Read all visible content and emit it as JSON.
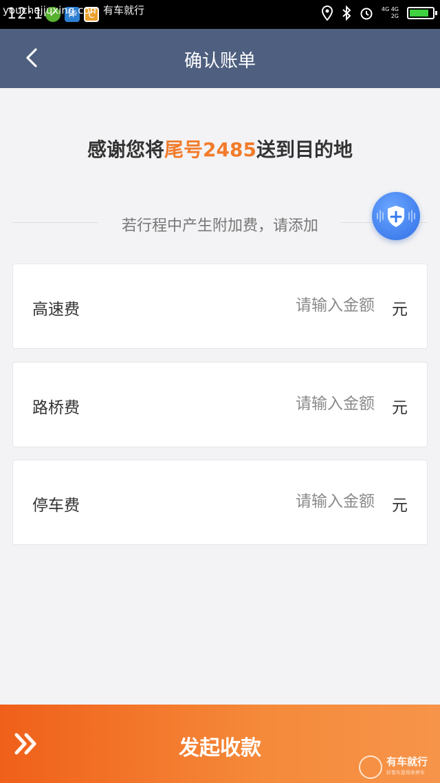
{
  "status_bar": {
    "time": "12:14",
    "watermark": "youchejiuxing.com 有车就行",
    "app_icons": [
      "app-green-icon",
      "app-blue-icon",
      "app-orange-icon"
    ],
    "network_top": "4G 4G",
    "network_bottom": "2G",
    "battery_level": 0.85,
    "battery_color": "#3fd13f"
  },
  "header": {
    "title": "确认账单",
    "background": "#4e5f7f"
  },
  "thanks": {
    "prefix": "感谢您将",
    "highlight": "尾号2485",
    "suffix": "送到目的地",
    "highlight_color": "#f27b2a"
  },
  "hint": {
    "text": "若行程中产生附加费，请添加"
  },
  "fees": [
    {
      "label": "高速费",
      "placeholder": "请输入金额",
      "value": "",
      "unit": "元"
    },
    {
      "label": "路桥费",
      "placeholder": "请输入金额",
      "value": "",
      "unit": "元"
    },
    {
      "label": "停车费",
      "placeholder": "请输入金额",
      "value": "",
      "unit": "元"
    }
  ],
  "bottom": {
    "button_label": "发起收款",
    "watermark_brand": "有车就行",
    "watermark_sub": "好看车是用来养车"
  }
}
